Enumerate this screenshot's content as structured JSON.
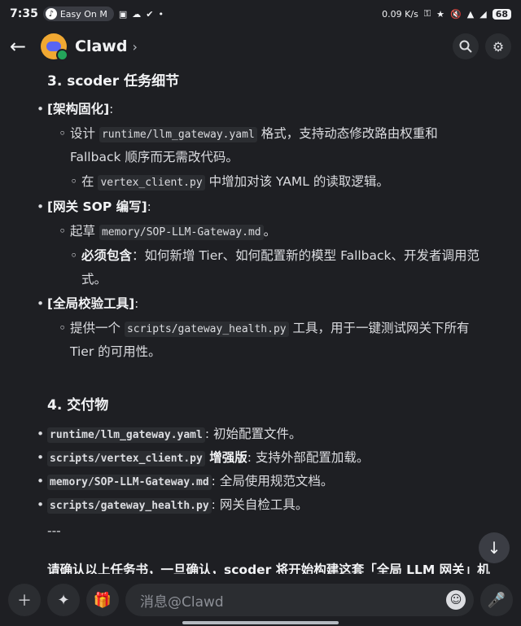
{
  "status_bar": {
    "time": "7:35",
    "pill_text": "Easy On M",
    "network_speed": "0.09 K/s",
    "battery": "68"
  },
  "header": {
    "back_icon": "arrow-left",
    "title": "Clawd",
    "chevron": "›"
  },
  "content": {
    "sec3": {
      "title": "3. scoder 任务细节",
      "b1_label": "[架构固化]",
      "b1_suffix": ":",
      "b1_s1_pre": "设计 ",
      "b1_s1_code": "runtime/llm_gateway.yaml",
      "b1_s1_post": " 格式，支持动态修改路由权重和",
      "b1_s1_line2": "Fallback 顺序而无需改代码。",
      "b1_s2_pre": "在 ",
      "b1_s2_code": "vertex_client.py",
      "b1_s2_post": " 中增加对该 YAML 的读取逻辑。",
      "b2_label": "[网关 SOP 编写]",
      "b2_suffix": ":",
      "b2_s1_pre": "起草 ",
      "b2_s1_code": "memory/SOP-LLM-Gateway.md",
      "b2_s1_post": "。",
      "b2_s2_bold": "必须包含",
      "b2_s2_post": "：如何新增 Tier、如何配置新的模型 Fallback、开发者调用范",
      "b2_s2_line2": "式。",
      "b3_label": "[全局校验工具]",
      "b3_suffix": ":",
      "b3_s1_pre": "提供一个 ",
      "b3_s1_code": "scripts/gateway_health.py",
      "b3_s1_post": " 工具，用于一键测试网关下所有",
      "b3_s1_line2": "Tier 的可用性。"
    },
    "sec4": {
      "title": "4. 交付物",
      "items": [
        {
          "code": "runtime/llm_gateway.yaml",
          "bold": "",
          "text": ": 初始配置文件。"
        },
        {
          "code": "scripts/vertex_client.py",
          "bold": " 增强版",
          "text": ": 支持外部配置加载。"
        },
        {
          "code": "memory/SOP-LLM-Gateway.md",
          "bold": "",
          "text": ": 全局使用规范文档。"
        },
        {
          "code": "scripts/gateway_health.py",
          "bold": "",
          "text": ": 网关自检工具。"
        }
      ],
      "divider": "---"
    },
    "partial_line": "请确认以上任务书，一旦确认，scoder 将开始构建这套「全局 LLM 网关」机"
  },
  "composer": {
    "placeholder": "消息@Clawd"
  },
  "colors": {
    "background": "#1e1f23",
    "surface": "#2b2d31",
    "accent": "#5865f2",
    "online": "#23a55a",
    "avatar": "#f0a832"
  }
}
